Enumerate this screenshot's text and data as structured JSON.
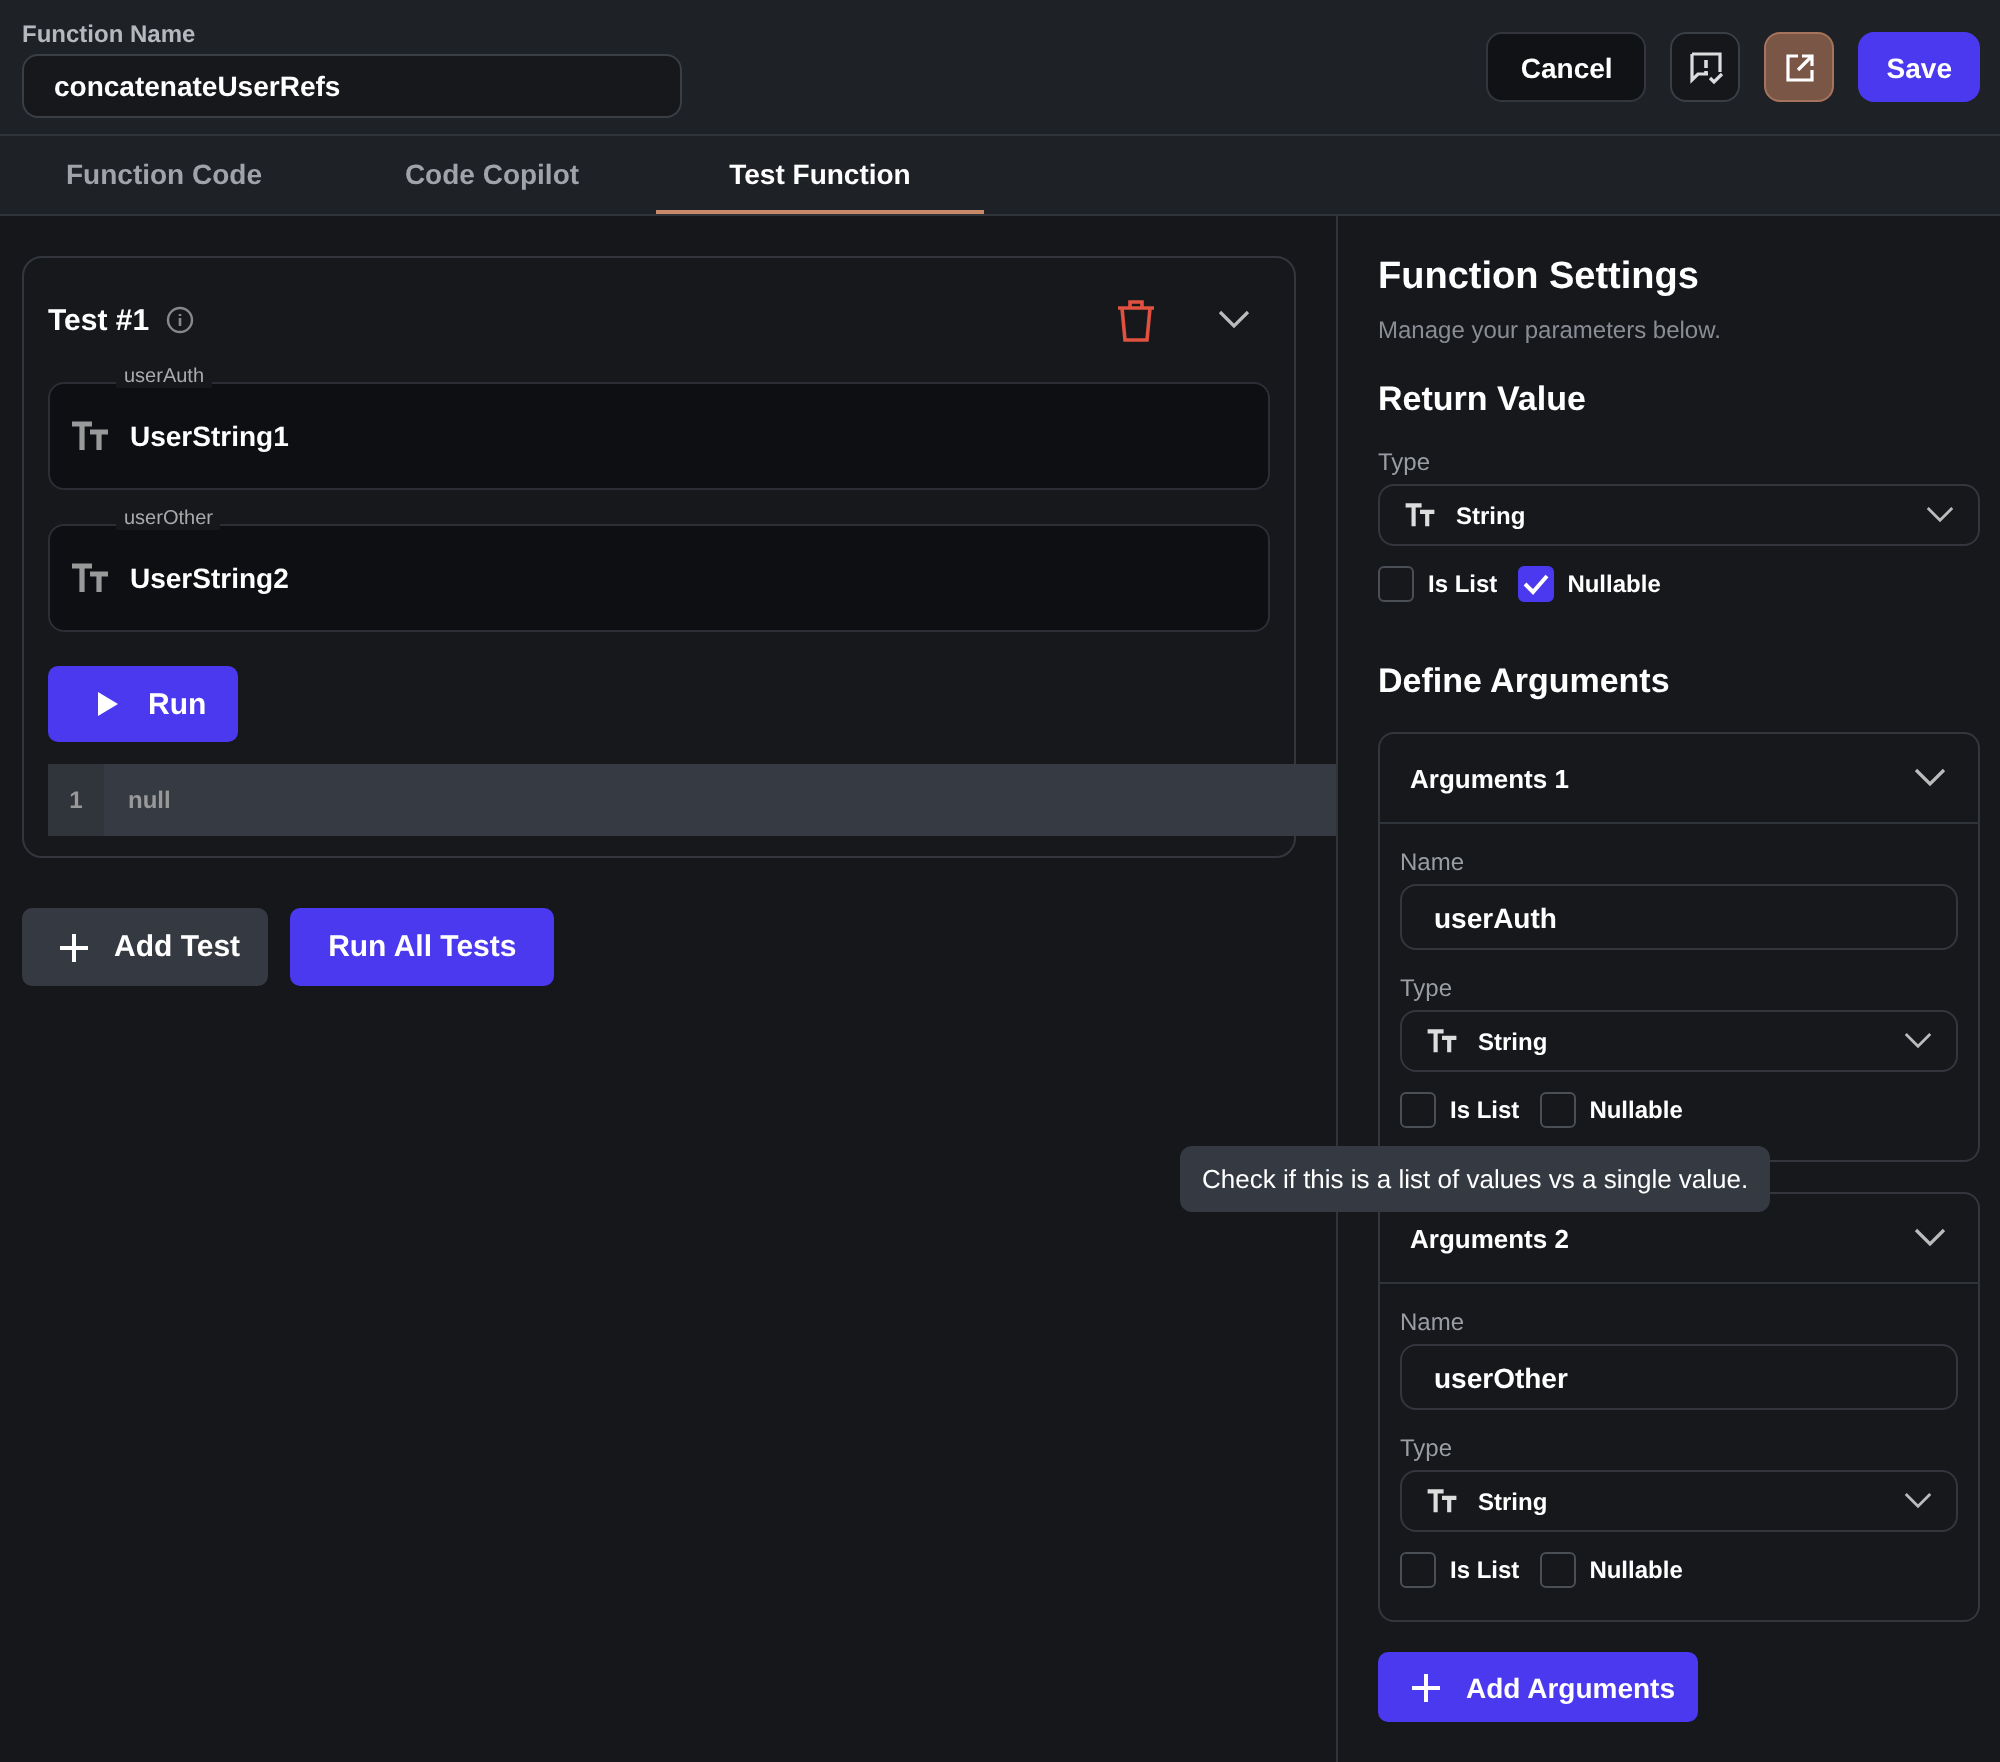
{
  "function_name": {
    "label": "Function Name",
    "value": "concatenateUserRefs"
  },
  "header_buttons": {
    "cancel": "Cancel",
    "save": "Save"
  },
  "tabs": [
    {
      "label": "Function Code",
      "selected": false
    },
    {
      "label": "Code Copilot",
      "selected": false
    },
    {
      "label": "Test Function",
      "selected": true
    }
  ],
  "test": {
    "title": "Test #1",
    "expanded": true,
    "inputs": [
      {
        "label": "userAuth",
        "value": "UserString1"
      },
      {
        "label": "userOther",
        "value": "UserString2"
      }
    ],
    "run": "Run",
    "output": {
      "line": "1",
      "text": "null"
    }
  },
  "add_test": "Add Test",
  "run_all": "Run All Tests",
  "settings": {
    "title": "Function Settings",
    "subtitle": "Manage your parameters below.",
    "return_title": "Return Value",
    "type_label": "Type",
    "type_value": "String",
    "is_list": {
      "label": "Is List",
      "checked": false
    },
    "nullable": {
      "label": "Nullable",
      "checked": true
    }
  },
  "arguments_title": "Define Arguments",
  "arguments": [
    {
      "title": "Arguments 1",
      "expanded": true,
      "name_label": "Name",
      "name": "userAuth",
      "type_label": "Type",
      "type": "String",
      "is_list": {
        "label": "Is List",
        "checked": false,
        "tooltip": "Check if this is a list of values vs a single value."
      },
      "nullable": {
        "label": "Nullable",
        "checked": false
      }
    },
    {
      "title": "Arguments 2",
      "expanded": true,
      "name_label": "Name",
      "name": "userOther",
      "type_label": "Type",
      "type": "String",
      "is_list": {
        "label": "Is List",
        "checked": false
      },
      "nullable": {
        "label": "Nullable",
        "checked": false
      }
    }
  ],
  "add_arguments": "Add Arguments"
}
